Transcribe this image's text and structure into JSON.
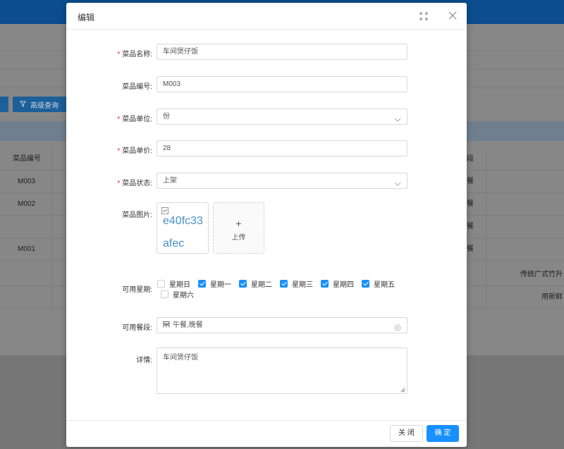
{
  "background": {
    "advanced_search_label": "高级查询",
    "table": {
      "col_dish_code": "菜品编号",
      "col_partial_right": "段",
      "rows": [
        {
          "code": "M003",
          "right": "餐",
          "desc": ""
        },
        {
          "code": "M002",
          "right": "餐",
          "desc": ""
        },
        {
          "code": "",
          "right": "餐",
          "desc": ""
        },
        {
          "code": "M001",
          "right": "餐",
          "desc": ""
        },
        {
          "code": "",
          "right": "",
          "desc": "传统广式竹升"
        },
        {
          "code": "",
          "right": "",
          "desc": "用新鲜"
        }
      ]
    }
  },
  "dialog": {
    "title": "编辑",
    "form": {
      "dish_name": {
        "label": "菜品名称",
        "value": "车间煲仔饭"
      },
      "dish_code": {
        "label": "菜品编号",
        "value": "M003"
      },
      "dish_unit": {
        "label": "菜品单位",
        "value": "份"
      },
      "dish_price": {
        "label": "菜品单价",
        "value": "28"
      },
      "dish_status": {
        "label": "菜品状态",
        "value": "上架"
      },
      "dish_image": {
        "label": "菜品图片",
        "alt_text": "e40fc33afec",
        "upload_label": "上传"
      },
      "weekdays": {
        "label": "可用星期",
        "options": [
          {
            "label": "星期日",
            "checked": false
          },
          {
            "label": "星期一",
            "checked": true
          },
          {
            "label": "星期二",
            "checked": true
          },
          {
            "label": "星期三",
            "checked": true
          },
          {
            "label": "星期四",
            "checked": true
          },
          {
            "label": "星期五",
            "checked": true
          },
          {
            "label": "星期六",
            "checked": false
          }
        ]
      },
      "meal_periods": {
        "label": "可用餐段",
        "value": "午餐,晚餐",
        "icon": "grid-icon"
      },
      "details": {
        "label": "详情",
        "value": "车间煲仔饭"
      }
    },
    "footer": {
      "close_label": "关 闭",
      "ok_label": "确 定"
    }
  },
  "colors": {
    "primary": "#1890ff",
    "required": "#f5222d",
    "header_bar": "#0b4d8e"
  }
}
